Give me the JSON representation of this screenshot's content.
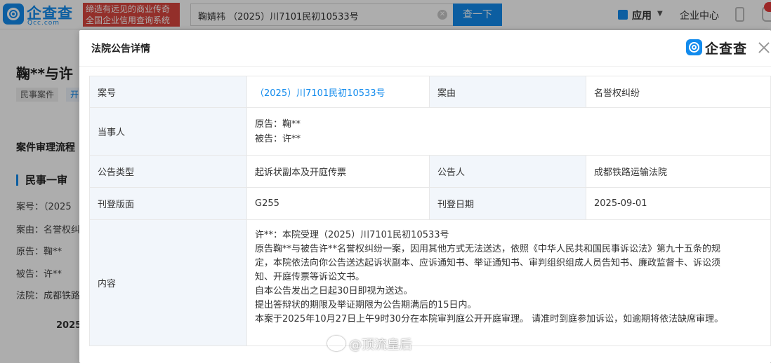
{
  "topbar": {
    "logo_name": "企查查",
    "logo_sub": "Qcc.com",
    "slogan_line1": "缔造有远见的商业传奇",
    "slogan_line2": "全国企业信用查询系统",
    "search_value": "鞠婧祎 （2025）川7101民初10533号",
    "search_button": "查一下",
    "apps_label": "应用",
    "enterprise_center": "企业中心"
  },
  "background": {
    "title": "鞠**与许",
    "tags": [
      "民事案件",
      "开"
    ],
    "section_title": "案件审理流程",
    "stage": "民事一审",
    "lines": [
      "案号：（2025",
      "案由：名誉权纠",
      "原告：鞠**",
      "被告：许**",
      "法院：成都铁路"
    ],
    "year": "2025"
  },
  "modal": {
    "title": "法院公告详情",
    "logo_name": "企查查",
    "rows": {
      "case_no_label": "案号",
      "case_no_value": "（2025）川7101民初10533号",
      "cause_label": "案由",
      "cause_value": "名誉权纠纷",
      "parties_label": "当事人",
      "plaintiff": "原告：鞠**",
      "defendant": "被告：许**",
      "type_label": "公告类型",
      "type_value": "起诉状副本及开庭传票",
      "announcer_label": "公告人",
      "announcer_value": "成都铁路运输法院",
      "layout_label": "刊登版面",
      "layout_value": "G255",
      "date_label": "刊登日期",
      "date_value": "2025-09-01",
      "content_label": "内容",
      "content_lines": [
        "许**：本院受理（2025）川7101民初10533号",
        "原告鞠**与被告许**名誉权纠纷一案，因用其他方式无法送达，依照《中华人民共和国民事诉讼法》第九十五条的规",
        "定，本院依法向你公告送达起诉状副本、应诉通知书、举证通知书、审判组织组成人员告知书、廉政监督卡、诉讼须",
        "知、开庭传票等诉讼文书。",
        "自本公告发出之日起30日即视为送达。",
        "提出答辩状的期限及举证期限为公告期满后的15日内。",
        "本案于2025年10月27日上午9时30分在本院审判庭公开开庭审理。 请准时到庭参加诉讼，如逾期将依法缺席审理。"
      ]
    }
  },
  "watermark": "@顶流皇后",
  "colors": {
    "brand": "#128bed",
    "slogan_bg": "#d9463e",
    "label_bg": "#f2f6fb"
  }
}
